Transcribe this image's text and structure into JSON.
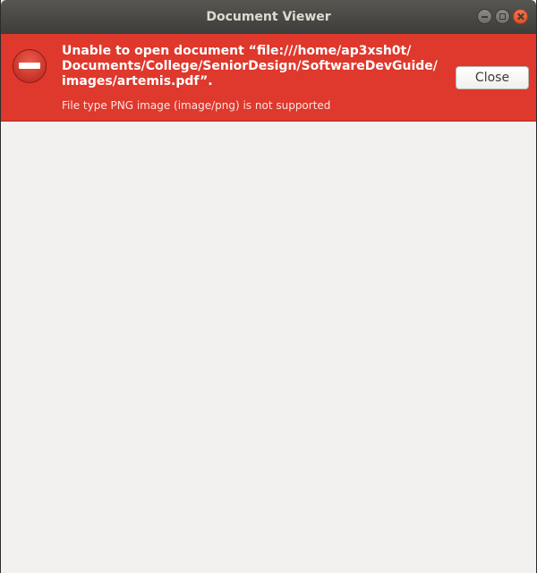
{
  "window": {
    "title": "Document Viewer"
  },
  "infobar": {
    "primary_message": "Unable to open document “file:///home/ap3xsh0t/\nDocuments/College/SeniorDesign/SoftwareDevGuide/\nimages/artemis.pdf”.",
    "secondary_message": "File type PNG image (image/png) is not supported",
    "close_label": "Close",
    "icon": "error-icon",
    "background_color": "#df382c"
  }
}
